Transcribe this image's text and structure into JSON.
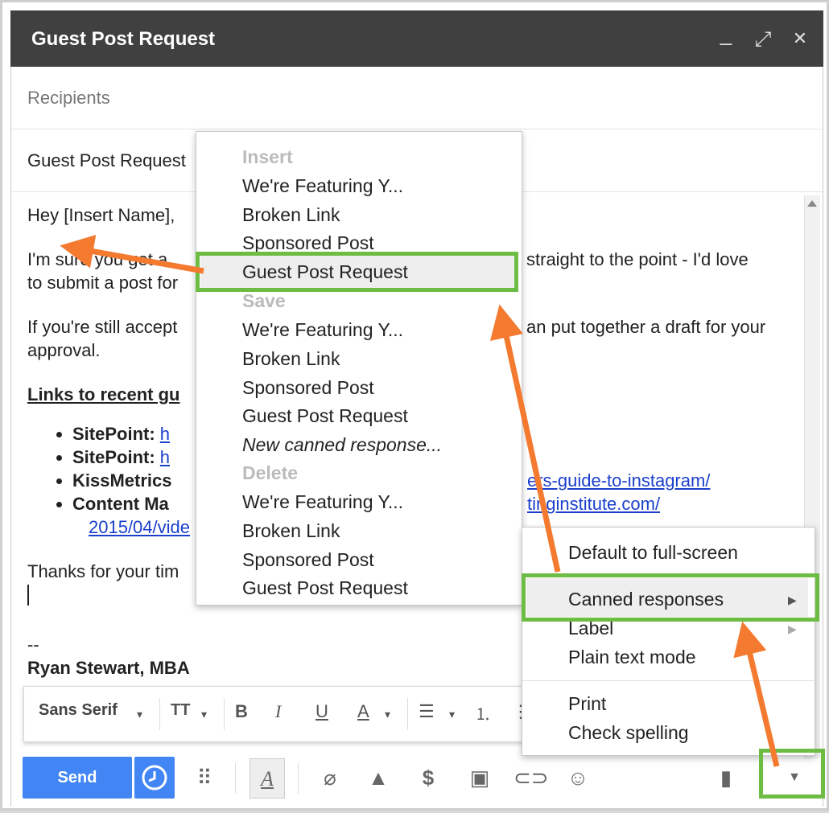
{
  "window": {
    "title": "Guest Post Request",
    "minimize_glyph": "_",
    "expand_glyph": "⤢",
    "close_glyph": "✕"
  },
  "compose": {
    "recipients_placeholder": "Recipients",
    "subject": "Guest Post Request",
    "body": {
      "greeting": "Hey [Insert Name],",
      "para1_left": "I'm sure you get a",
      "para1_right": "straight to the point - I'd love",
      "para1_line2": "to submit a post for",
      "para2_left": "If you're still accept",
      "para2_right": "an put together a draft for your",
      "para2_line2": "approval.",
      "links_heading": "Links to recent gu",
      "links": [
        {
          "label": "SitePoint",
          "sep": ": ",
          "url": "h"
        },
        {
          "label": "SitePoint",
          "sep": ": ",
          "url": "h"
        },
        {
          "label": "KissMetrics",
          "sep": "",
          "url": ""
        },
        {
          "label": "Content Ma",
          "sep": "",
          "url": ""
        }
      ],
      "link3_right": "ers-guide-to-instagram/",
      "link4_right": "tinginstitute.com/",
      "link4_line2": "2015/04/vide",
      "thanks": "Thanks for your tim",
      "sig_dash": "--",
      "sig_name": "Ryan Stewart, MBA"
    }
  },
  "formatting_bar": {
    "font_name": "Sans Serif",
    "size_icon": "TT",
    "bold": "B",
    "italic": "I",
    "underline": "U",
    "text_color": "A"
  },
  "bottom_bar": {
    "send_label": "Send"
  },
  "insert_menu": {
    "insert_header": "Insert",
    "insert_items": [
      "We're Featuring Y...",
      "Broken Link",
      "Sponsored Post",
      "Guest Post Request"
    ],
    "save_header": "Save",
    "save_items": [
      "We're Featuring Y...",
      "Broken Link",
      "Sponsored Post",
      "Guest Post Request"
    ],
    "new_item": "New canned response...",
    "delete_header": "Delete",
    "delete_items": [
      "We're Featuring Y...",
      "Broken Link",
      "Sponsored Post",
      "Guest Post Request"
    ]
  },
  "more_menu": {
    "items": [
      "Default to full-screen",
      "Canned responses",
      "Label",
      "Plain text mode",
      "Print",
      "Check spelling"
    ],
    "submenu_arrow": "▶"
  },
  "colors": {
    "highlight": "#6dbd45",
    "annotation_arrow": "#f47a30",
    "send_blue": "#4285f4",
    "titlebar": "#404040"
  }
}
